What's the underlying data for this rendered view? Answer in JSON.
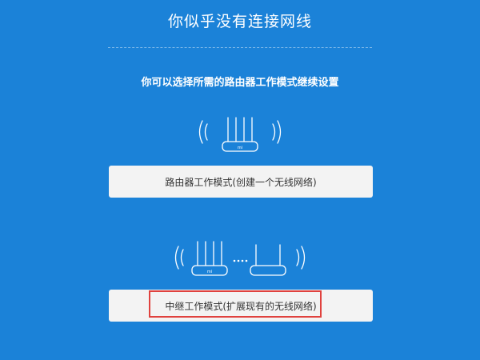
{
  "header": {
    "title": "你似乎没有连接网线",
    "subtitle": "你可以选择所需的路由器工作模式继续设置"
  },
  "modes": [
    {
      "label": "路由器工作模式(创建一个无线网络)",
      "icon": "router-antennas-icon"
    },
    {
      "label": "中继工作模式(扩展现有的无线网络)",
      "icon": "router-relay-icon"
    }
  ],
  "colors": {
    "background": "#1b82d8",
    "button_bg": "#f3f3f3",
    "highlight_border": "#e0423e",
    "text_light": "#ffffff",
    "text_dark": "#333333"
  }
}
